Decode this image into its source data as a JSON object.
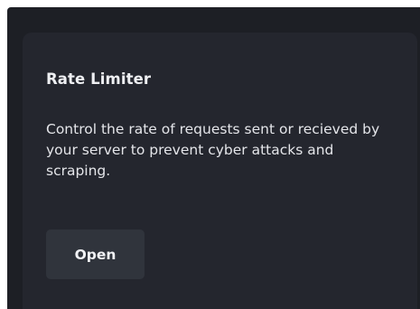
{
  "card": {
    "title": "Rate Limiter",
    "description": "Control the rate of requests sent or recieved by your server to prevent cyber attacks and scraping.",
    "button_label": "Open"
  },
  "colors": {
    "background": "#1d1f25",
    "card": "#24262e",
    "button": "#30343c",
    "text": "#eeeff2"
  }
}
